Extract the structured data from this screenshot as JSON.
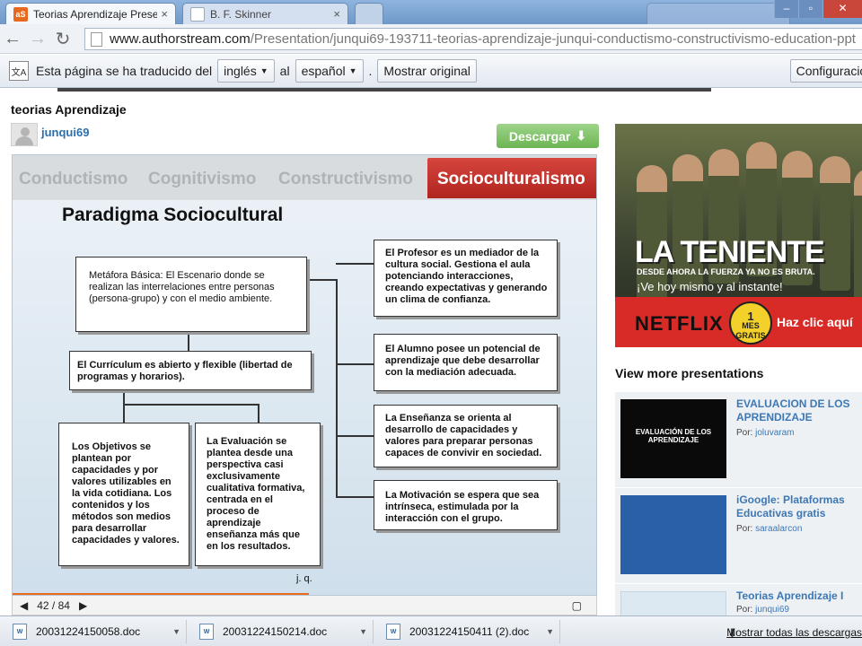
{
  "browser": {
    "tabs": [
      {
        "title": "Teorias Aprendizaje Presen",
        "favicon": "aS",
        "active": true
      },
      {
        "title": "B. F. Skinner",
        "favicon": "W",
        "active": false
      }
    ],
    "address": {
      "host": "www.authorstream.com",
      "path": "/Presentation/junqui69-193711-teorias-aprendizaje-junqui-conductismo-constructivismo-education-ppt"
    }
  },
  "translate_bar": {
    "text_before": "Esta página se ha traducido del",
    "from_lang": "inglés",
    "connector": "al",
    "to_lang": "español",
    "dot": ".",
    "show_original": "Mostrar original",
    "config": "Configuración"
  },
  "presentation": {
    "title": "teorias Aprendizaje",
    "author": "junqui69",
    "download": "Descargar"
  },
  "slide": {
    "nav_tabs": [
      "Conductismo",
      "Cognitivismo",
      "Constructivismo",
      "Socioculturalismo"
    ],
    "heading": "Paradigma Sociocultural",
    "box_metafora": "Metáfora Básica: El Escenario donde se realizan las interrelaciones entre personas (persona-grupo) y con el medio ambiente.",
    "box_curriculum": "El Currículum es abierto y flexible (libertad de programas y horarios).",
    "box_objetivos": "Los Objetivos se plantean por capacidades y por valores utilizables en la vida cotidiana. Los contenidos y los métodos son medios para desarrollar capacidades y valores.",
    "box_evaluacion": "La Evaluación se plantea desde una perspectiva casi exclusivamente cualitativa formativa, centrada en el proceso de aprendizaje enseñanza más que en los resultados.",
    "box_profesor": "El Profesor es un mediador de la cultura social. Gestiona el aula potenciando interacciones, creando expectativas y generando un clima de confianza.",
    "box_alumno": "El Alumno posee un potencial de aprendizaje que debe desarrollar con la mediación adecuada.",
    "box_ensenanza": "La Enseñanza se orienta al desarrollo de capacidades y valores para preparar personas capaces de convivir en sociedad.",
    "box_motivacion": "La Motivación se espera que sea intrínseca, estimulada por la interacción con el grupo.",
    "signature": "j. q.",
    "page_counter": "42 / 84"
  },
  "ad": {
    "logo": "LA TENIENTE",
    "tagline": "DESDE AHORA LA FUERZA YA NO ES BRUTA.",
    "tagline2": "¡Ve hoy mismo y al instante!",
    "netflix": "NETFLIX",
    "badge_num": "1",
    "badge_a": "MES",
    "badge_b": "GRATIS",
    "cta": "Haz clic aquí"
  },
  "related": {
    "heading": "View more presentations",
    "by_label": "Por:",
    "items": [
      {
        "title": "EVALUACION DE LOS APRENDIZAJE",
        "author": "joluvaram",
        "thumb_text": "EVALUACIÓN DE LOS APRENDIZAJE"
      },
      {
        "title": "iGoogle: Plataformas Educativas gratis",
        "author": "saraalarcon"
      },
      {
        "title": "Teorias Aprendizaje I",
        "author": "junqui69"
      }
    ]
  },
  "downloads": {
    "files": [
      "20031224150058.doc",
      "20031224150214.doc",
      "20031224150411 (2).doc"
    ],
    "show_all": "Mostrar todas las descargas..."
  }
}
